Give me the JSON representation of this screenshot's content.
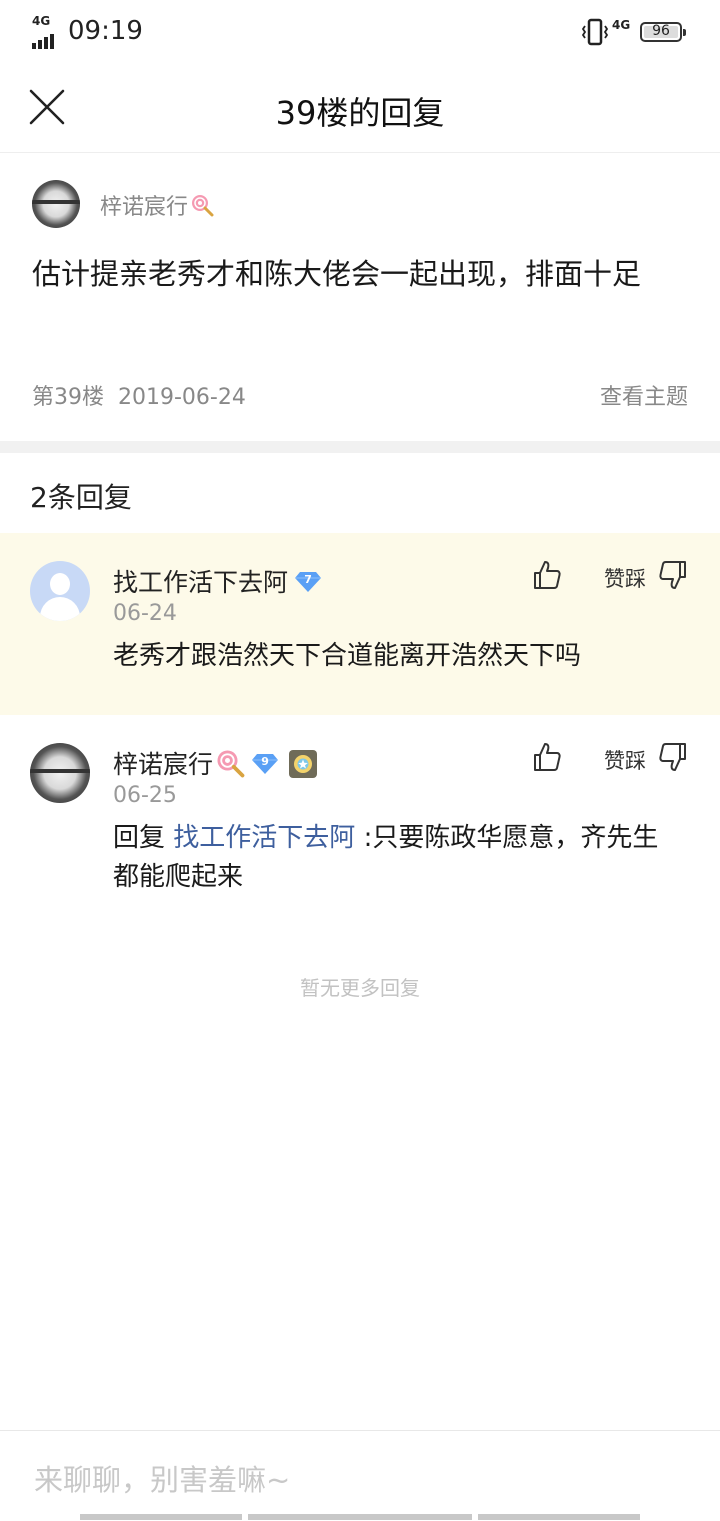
{
  "status_bar": {
    "network_left": "4G",
    "time": "09:19",
    "network_right": "4G",
    "battery": "96"
  },
  "nav": {
    "title": "39楼的回复",
    "close_icon": "close-icon"
  },
  "post": {
    "author": "梓诺宸行",
    "content": "估计提亲老秀才和陈大佬会一起出现，排面十足",
    "floor": "第39楼",
    "date": "2019-06-24",
    "view_topic": "查看主题"
  },
  "reply_count": "2条回复",
  "replies": [
    {
      "name": "找工作活下去阿",
      "level": "7",
      "date": "06-24",
      "text": "老秀才跟浩然天下合道能离开浩然天下吗",
      "vote_label": "赞踩",
      "highlight_color": "#fdfae9"
    },
    {
      "name": "梓诺宸行",
      "level": "9",
      "date": "06-25",
      "reply_prefix": "回复",
      "reply_to": "找工作活下去阿",
      "text": ":只要陈政华愿意，齐先生都能爬起来",
      "vote_label": "赞踩"
    }
  ],
  "no_more": "暂无更多回复",
  "input": {
    "placeholder": "来聊聊，别害羞嘛~"
  },
  "colors": {
    "link": "#3e5f9e",
    "gem_badge": "#5aa0f5",
    "highlight_bg": "#fdfae9"
  }
}
